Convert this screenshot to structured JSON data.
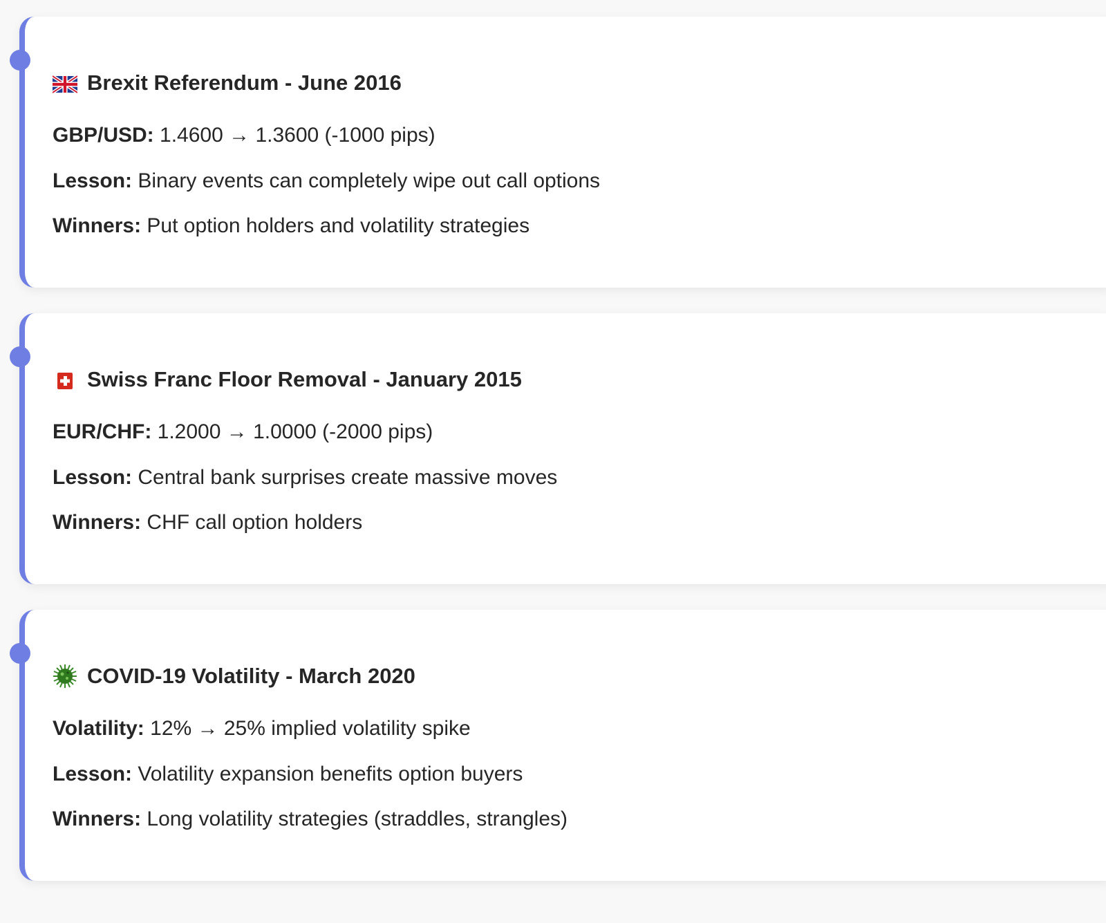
{
  "events": [
    {
      "icon": "uk-flag-icon",
      "title": "Brexit Referendum - June 2016",
      "lines": [
        {
          "label": "GBP/USD:",
          "text": " 1.4600 → 1.3600 (-1000 pips)"
        },
        {
          "label": "Lesson:",
          "text": " Binary events can completely wipe out call options"
        },
        {
          "label": "Winners:",
          "text": " Put option holders and volatility strategies"
        }
      ]
    },
    {
      "icon": "swiss-flag-icon",
      "title": "Swiss Franc Floor Removal - January 2015",
      "lines": [
        {
          "label": "EUR/CHF:",
          "text": " 1.2000 → 1.0000 (-2000 pips)"
        },
        {
          "label": "Lesson:",
          "text": " Central bank surprises create massive moves"
        },
        {
          "label": "Winners:",
          "text": " CHF call option holders"
        }
      ]
    },
    {
      "icon": "virus-icon",
      "title": "COVID-19 Volatility - March 2020",
      "lines": [
        {
          "label": "Volatility:",
          "text": " 12% → 25% implied volatility spike"
        },
        {
          "label": "Lesson:",
          "text": " Volatility expansion benefits option buyers"
        },
        {
          "label": "Winners:",
          "text": " Long volatility strategies (straddles, strangles)"
        }
      ]
    }
  ],
  "colors": {
    "accent": "#6f7ee3",
    "card_bg": "#ffffff",
    "page_bg": "#f8f8f9",
    "text": "#262626"
  }
}
